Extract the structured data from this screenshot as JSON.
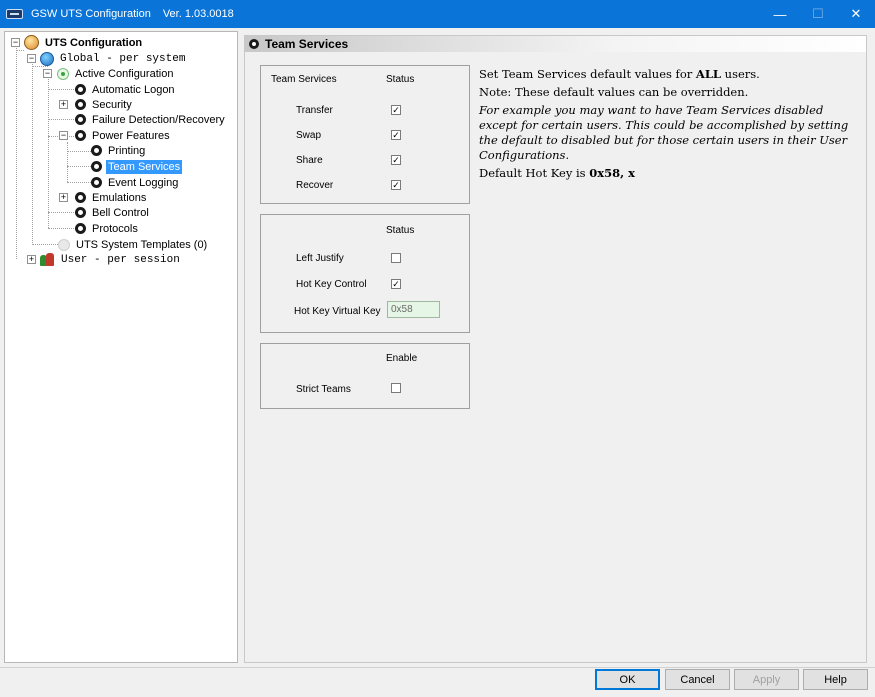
{
  "window": {
    "app_name": "GSW UTS Configuration",
    "version": "Ver. 1.03.0018",
    "minimize": "—",
    "maximize": "☐",
    "close": "✕"
  },
  "tree": {
    "root": "UTS Configuration",
    "global": "Global  - per system",
    "active_configuration": "Active Configuration",
    "automatic_logon": "Automatic Logon",
    "security": "Security",
    "failure_detection": "Failure Detection/Recovery",
    "power_features": "Power Features",
    "printing": "Printing",
    "team_services": "Team Services",
    "event_logging": "Event Logging",
    "emulations": "Emulations",
    "bell_control": "Bell Control",
    "protocols": "Protocols",
    "templates": "UTS System Templates (0)",
    "user": "User   - per session",
    "expand_plus": "+",
    "collapse_minus": "−"
  },
  "panel": {
    "title": "Team Services",
    "group1": {
      "col1": "Team Services",
      "col2": "Status",
      "rows": [
        {
          "label": "Transfer",
          "checked": "✓"
        },
        {
          "label": "Swap",
          "checked": "✓"
        },
        {
          "label": "Share",
          "checked": "✓"
        },
        {
          "label": "Recover",
          "checked": "✓"
        }
      ]
    },
    "group2": {
      "col2": "Status",
      "left_justify": "Left Justify",
      "left_justify_checked": "",
      "hot_key_control": "Hot Key Control",
      "hot_key_control_checked": "✓",
      "hot_key_virtual_key": "Hot Key Virtual Key",
      "hot_key_value": "0x58"
    },
    "group3": {
      "col2": "Enable",
      "strict_teams": "Strict Teams",
      "strict_teams_checked": ""
    },
    "info": {
      "line1_pre": "Set Team Services default values for ",
      "line1_bold": "ALL",
      "line1_post": " users.",
      "line2": "Note: These default values can be overridden.",
      "line3": "For example you may want to have Team Services disabled except for certain users. This could be accomplished by setting the default to disabled but for those certain users in their User Configurations.",
      "line4_pre": "Default Hot Key is ",
      "line4_bold": "0x58, x"
    }
  },
  "footer": {
    "ok": "OK",
    "cancel": "Cancel",
    "apply": "Apply",
    "help": "Help"
  }
}
